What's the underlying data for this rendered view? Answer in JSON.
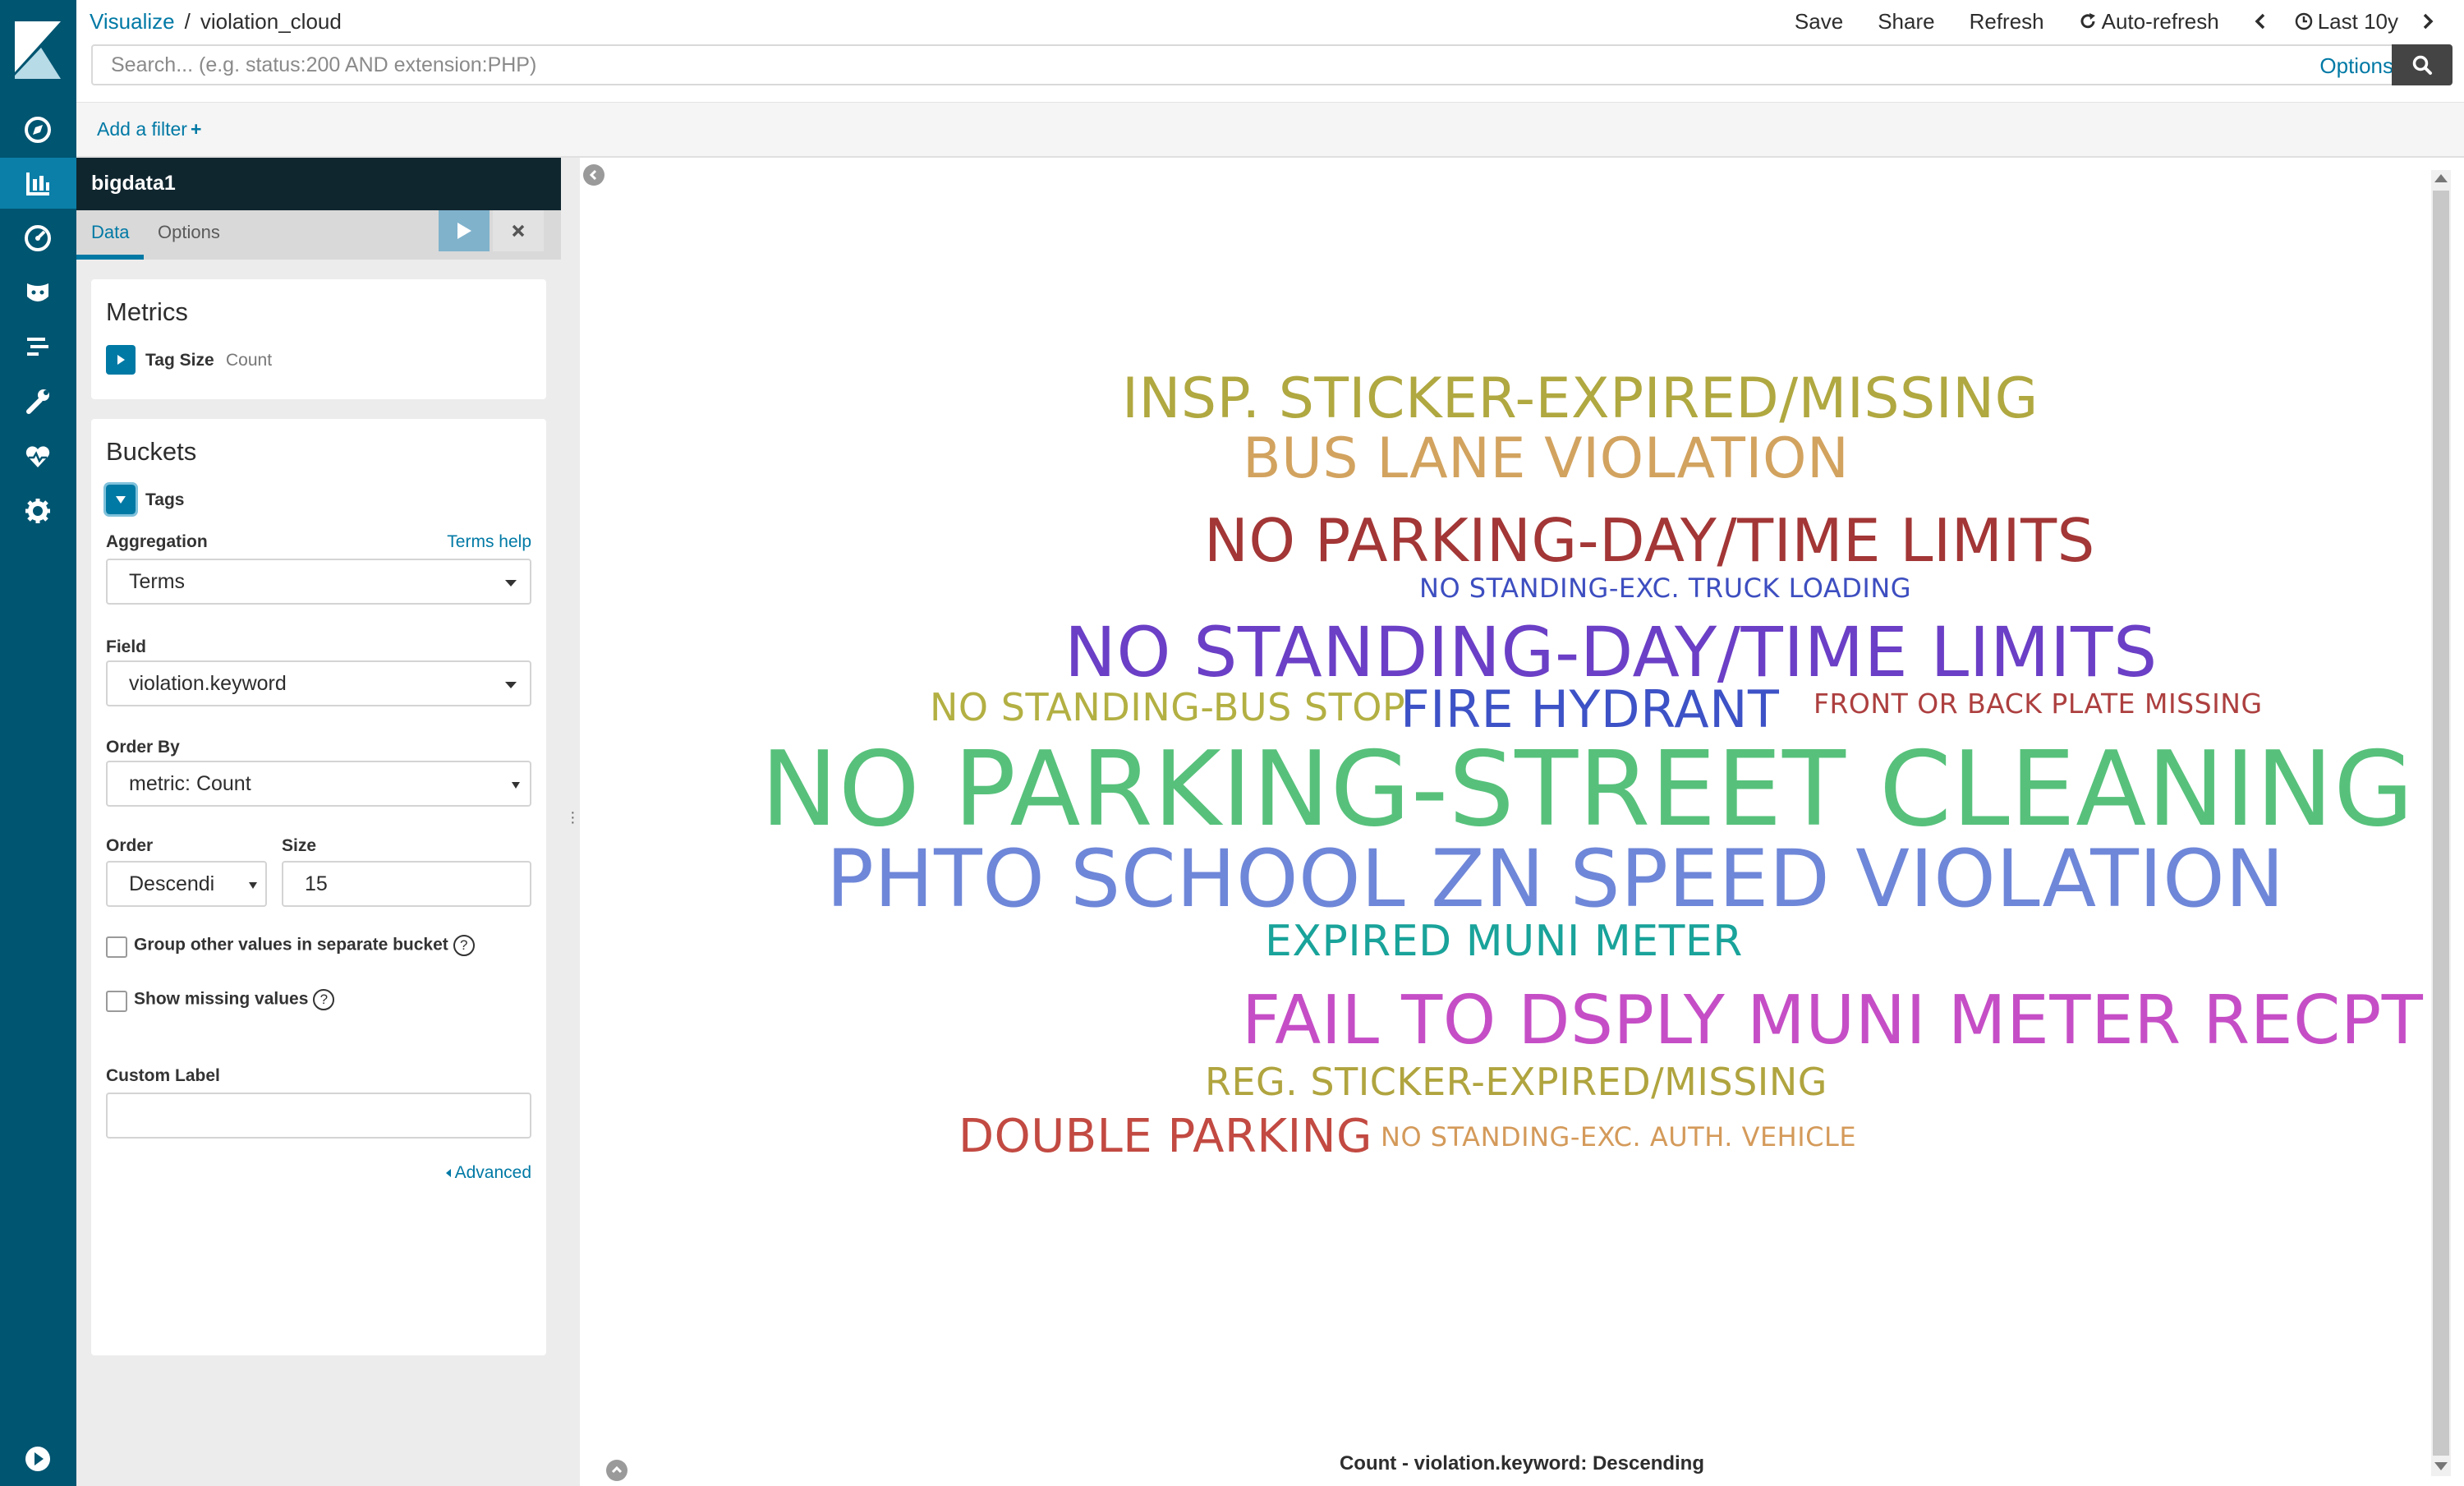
{
  "colors": {
    "nav_bg": "#005571",
    "nav_active": "#0b7fa8",
    "link": "#0079a5",
    "index_header": "#10262f"
  },
  "breadcrumb": {
    "root": "Visualize",
    "separator": "/",
    "current": "violation_cloud"
  },
  "top_actions": {
    "save": "Save",
    "share": "Share",
    "refresh": "Refresh",
    "auto_refresh": "Auto-refresh",
    "time_range": "Last 10y"
  },
  "search": {
    "placeholder": "Search... (e.g. status:200 AND extension:PHP)",
    "options_label": "Options"
  },
  "filter": {
    "add_filter": "Add a filter",
    "plus": "+"
  },
  "nav_icons": [
    "discover-icon",
    "visualize-icon",
    "dashboard-icon",
    "timelion-icon",
    "apm-icon",
    "dev-tools-icon",
    "monitoring-icon",
    "management-icon",
    "collapse-nav-icon"
  ],
  "editor": {
    "index_pattern": "bigdata1",
    "tabs": [
      "Data",
      "Options"
    ],
    "metrics": {
      "title": "Metrics",
      "agg_name": "Tag Size",
      "agg_type": "Count"
    },
    "buckets": {
      "title": "Buckets",
      "agg_name": "Tags",
      "aggregation_label": "Aggregation",
      "terms_help": "Terms help",
      "aggregation_value": "Terms",
      "field_label": "Field",
      "field_value": "violation.keyword",
      "order_by_label": "Order By",
      "order_by_value": "metric: Count",
      "order_label": "Order",
      "order_value": "Descendi",
      "size_label": "Size",
      "size_value": "15",
      "group_other": "Group other values in separate bucket",
      "show_missing": "Show missing values",
      "help_glyph": "?",
      "custom_label": "Custom Label",
      "custom_label_value": "",
      "advanced": "Advanced"
    }
  },
  "chart_data": {
    "type": "tag-cloud",
    "title": "Count - violation.keyword: Descending",
    "words": [
      {
        "text": "INSP. STICKER-EXPIRED/MISSING",
        "color": "#b0a840"
      },
      {
        "text": "BUS LANE VIOLATION",
        "color": "#d2a35f"
      },
      {
        "text": "NO PARKING-DAY/TIME LIMITS",
        "color": "#a33636"
      },
      {
        "text": "NO STANDING-EXC. TRUCK LOADING",
        "color": "#3d4ec0"
      },
      {
        "text": "NO STANDING-DAY/TIME LIMITS",
        "color": "#6b3fc6"
      },
      {
        "text": "NO STANDING-BUS STOP",
        "color": "#b3b043"
      },
      {
        "text": "FIRE HYDRANT",
        "color": "#3d52c6"
      },
      {
        "text": "FRONT OR BACK PLATE MISSING",
        "color": "#ad3f3f"
      },
      {
        "text": "NO PARKING-STREET CLEANING",
        "color": "#57c17b"
      },
      {
        "text": "PHTO SCHOOL ZN SPEED VIOLATION",
        "color": "#6f87d8"
      },
      {
        "text": "EXPIRED MUNI METER",
        "color": "#19a39a"
      },
      {
        "text": "FAIL TO DSPLY MUNI METER RECPT",
        "color": "#c54ec6"
      },
      {
        "text": "REG. STICKER-EXPIRED/MISSING",
        "color": "#b0a43f"
      },
      {
        "text": "DOUBLE PARKING",
        "color": "#c24a42"
      },
      {
        "text": "NO STANDING-EXC. AUTH. VEHICLE",
        "color": "#d49a5a"
      }
    ]
  }
}
